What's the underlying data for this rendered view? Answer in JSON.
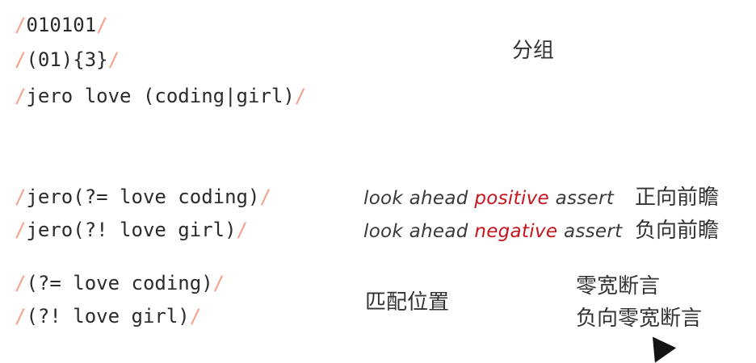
{
  "group1": {
    "lines": [
      "010101",
      "(01){3}",
      "jero love (coding|girl)"
    ],
    "label": "分组"
  },
  "group2": {
    "line1": {
      "code": "jero(?= love coding)",
      "desc_pre": "look ahead",
      "desc_highlight": "positive",
      "desc_post": "assert",
      "cn": "正向前瞻"
    },
    "line2": {
      "code": "jero(?! love girl)",
      "desc_pre": "look ahead",
      "desc_highlight": "negative",
      "desc_post": "assert",
      "cn": "负向前瞻"
    }
  },
  "group3": {
    "lines": [
      "(?= love coding)",
      "(?! love girl)"
    ],
    "label": "匹配位置",
    "notes": [
      "零宽断言",
      "负向零宽断言"
    ]
  },
  "delimiter": "/",
  "colors": {
    "slash": "#f2a08a",
    "highlight": "#c8141c"
  }
}
